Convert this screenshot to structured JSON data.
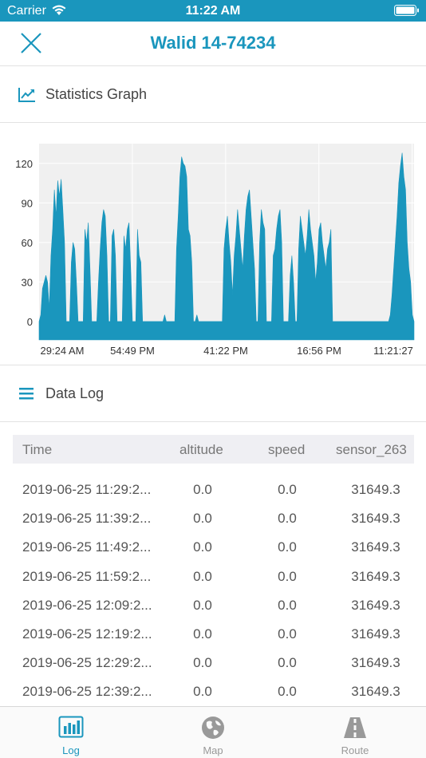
{
  "status_bar": {
    "carrier": "Carrier",
    "time": "11:22 AM"
  },
  "nav": {
    "title": "Walid 14-74234"
  },
  "stats_section": {
    "label": "Statistics Graph"
  },
  "log_section": {
    "label": "Data Log"
  },
  "chart_data": {
    "type": "area",
    "title": "",
    "xlabel": "",
    "ylabel": "",
    "ylim": [
      -14,
      135
    ],
    "y_ticks": [
      "0",
      "30",
      "60",
      "90",
      "120"
    ],
    "x_ticks": [
      "29:24 AM",
      "54:49 PM",
      "41:22 PM",
      "16:56 PM",
      "11:21:27"
    ],
    "grid": true,
    "color": "#1a96bd",
    "series": [
      {
        "values": [
          0,
          5,
          25,
          30,
          35,
          30,
          10,
          50,
          70,
          100,
          80,
          107,
          95,
          108,
          85,
          60,
          0,
          0,
          0,
          45,
          60,
          55,
          30,
          0,
          0,
          0,
          0,
          70,
          60,
          75,
          40,
          0,
          0,
          0,
          0,
          30,
          55,
          75,
          85,
          80,
          50,
          0,
          0,
          65,
          70,
          50,
          0,
          0,
          0,
          0,
          65,
          55,
          70,
          75,
          40,
          0,
          0,
          0,
          70,
          50,
          45,
          0,
          0,
          0,
          0,
          0,
          0,
          0,
          0,
          0,
          0,
          0,
          0,
          0,
          5,
          0,
          0,
          0,
          0,
          0,
          0,
          55,
          80,
          110,
          125,
          120,
          118,
          110,
          70,
          65,
          45,
          0,
          0,
          5,
          0,
          0,
          0,
          0,
          0,
          0,
          0,
          0,
          0,
          0,
          0,
          0,
          0,
          0,
          0,
          55,
          70,
          80,
          60,
          45,
          20,
          50,
          65,
          85,
          70,
          55,
          40,
          65,
          85,
          95,
          100,
          80,
          60,
          40,
          0,
          0,
          60,
          85,
          75,
          70,
          0,
          0,
          0,
          0,
          50,
          55,
          70,
          80,
          85,
          60,
          0,
          0,
          0,
          0,
          35,
          50,
          30,
          0,
          0,
          55,
          80,
          70,
          60,
          50,
          65,
          85,
          70,
          60,
          50,
          30,
          45,
          70,
          75,
          60,
          50,
          40,
          55,
          60,
          70,
          0,
          0,
          0,
          0,
          0,
          0,
          0,
          0,
          0,
          0,
          0,
          0,
          0,
          0,
          0,
          0,
          0,
          0,
          0,
          0,
          0,
          0,
          0,
          0,
          0,
          0,
          0,
          0,
          0,
          0,
          0,
          0,
          0,
          0,
          5,
          20,
          40,
          60,
          80,
          105,
          118,
          128,
          110,
          100,
          60,
          40,
          30,
          5,
          0
        ]
      }
    ]
  },
  "table": {
    "columns": [
      "Time",
      "altitude",
      "speed",
      "sensor_263"
    ],
    "rows": [
      [
        "2019-06-25 11:29:2...",
        "0.0",
        "0.0",
        "31649.3"
      ],
      [
        "2019-06-25 11:39:2...",
        "0.0",
        "0.0",
        "31649.3"
      ],
      [
        "2019-06-25 11:49:2...",
        "0.0",
        "0.0",
        "31649.3"
      ],
      [
        "2019-06-25 11:59:2...",
        "0.0",
        "0.0",
        "31649.3"
      ],
      [
        "2019-06-25 12:09:2...",
        "0.0",
        "0.0",
        "31649.3"
      ],
      [
        "2019-06-25 12:19:2...",
        "0.0",
        "0.0",
        "31649.3"
      ],
      [
        "2019-06-25 12:29:2...",
        "0.0",
        "0.0",
        "31649.3"
      ],
      [
        "2019-06-25 12:39:2...",
        "0.0",
        "0.0",
        "31649.3"
      ]
    ]
  },
  "tabs": [
    {
      "label": "Log",
      "icon": "bar-chart-icon",
      "active": true
    },
    {
      "label": "Map",
      "icon": "globe-icon",
      "active": false
    },
    {
      "label": "Route",
      "icon": "road-icon",
      "active": false
    }
  ],
  "colors": {
    "accent": "#1a96bd",
    "header_bg": "#efeff3",
    "tab_inactive": "#999999"
  }
}
